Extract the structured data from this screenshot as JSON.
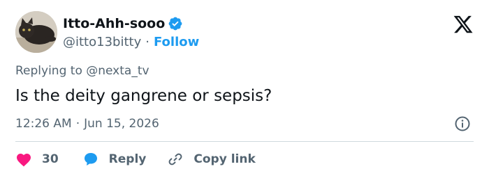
{
  "author": {
    "display_name": "Itto-Ahh-sooo",
    "handle": "@itto13bitty",
    "separator": "·",
    "follow_label": "Follow",
    "verified": true,
    "avatar_icon": "cat-avatar"
  },
  "reply_context": {
    "prefix": "Replying to",
    "mention": "@nexta_tv"
  },
  "tweet": {
    "text": "Is the deity gangrene or sepsis?",
    "time": "12:26 AM",
    "date_separator": "·",
    "date": "Jun 15, 2026"
  },
  "actions": {
    "like_count": "30",
    "reply_label": "Reply",
    "copy_label": "Copy link"
  },
  "colors": {
    "accent": "#1d9bf0",
    "like": "#f91880",
    "secondary_text": "#536471",
    "primary_text": "#0f1419",
    "divider": "#cfd9de"
  },
  "icons": {
    "verified": "verified-badge-icon",
    "logo": "x-logo-icon",
    "info": "info-icon",
    "like": "heart-icon",
    "reply": "reply-bubble-icon",
    "copy": "link-icon"
  }
}
